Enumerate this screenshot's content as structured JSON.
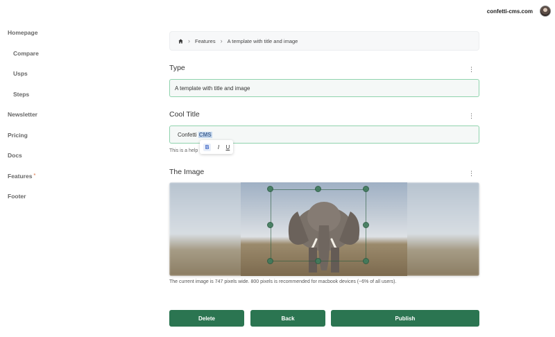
{
  "header": {
    "site_name": "confetti-cms.com"
  },
  "sidebar": {
    "items": [
      {
        "label": "Homepage",
        "level": "top"
      },
      {
        "label": "Compare",
        "level": "sub"
      },
      {
        "label": "Usps",
        "level": "sub"
      },
      {
        "label": "Steps",
        "level": "sub"
      },
      {
        "label": "Newsletter",
        "level": "top"
      },
      {
        "label": "Pricing",
        "level": "top"
      },
      {
        "label": "Docs",
        "level": "top"
      },
      {
        "label": "Features",
        "level": "top",
        "marker": "*"
      },
      {
        "label": "Footer",
        "level": "top"
      }
    ]
  },
  "breadcrumb": {
    "items": [
      "Features",
      "A template with title and image"
    ]
  },
  "type_section": {
    "title": "Type",
    "value": "A template with title and image"
  },
  "cool_title_section": {
    "title": "Cool Title",
    "value_plain": "Confetti ",
    "value_selected": "CMS",
    "helper": "This is a help"
  },
  "toolbar": {
    "bold": "B",
    "italic": "I",
    "underline": "U"
  },
  "image_section": {
    "title": "The Image",
    "info": "The current image is 747 pixels wide. 800 pixels is recommended for macbook devices (~6% of all users)."
  },
  "actions": {
    "delete": "Delete",
    "back": "Back",
    "publish": "Publish"
  },
  "colors": {
    "accent": "#2b7551",
    "field_border": "#8fd3ad",
    "selection": "#c5d8ee"
  }
}
